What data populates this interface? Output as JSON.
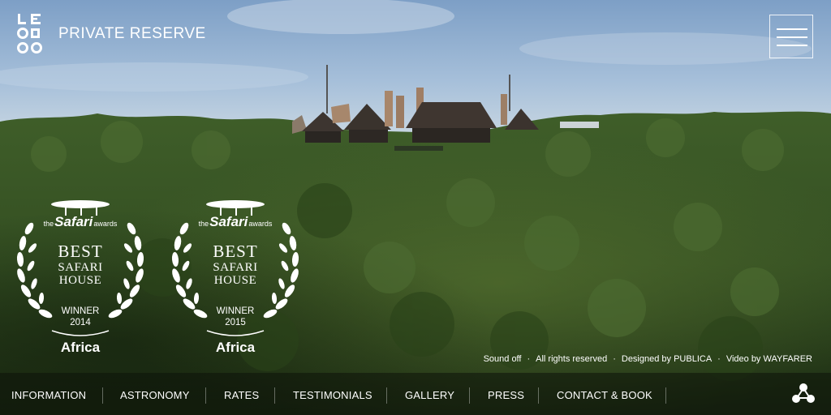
{
  "brand": {
    "name": "PRIVATE RESERVE",
    "logo_text": "LEOBO"
  },
  "header": {
    "menu_icon": "hamburger-icon"
  },
  "awards": [
    {
      "brand_pre": "the",
      "brand_main": "Safari",
      "brand_post": "awards",
      "title": "BEST",
      "line2": "SAFARI",
      "line3": "HOUSE",
      "winner": "WINNER",
      "year": "2014",
      "region": "Africa"
    },
    {
      "brand_pre": "the",
      "brand_main": "Safari",
      "brand_post": "awards",
      "title": "BEST",
      "line2": "SAFARI",
      "line3": "HOUSE",
      "winner": "WINNER",
      "year": "2015",
      "region": "Africa"
    }
  ],
  "footer": {
    "sound": "Sound off",
    "rights": "All rights reserved",
    "designed": "Designed by PUBLICA",
    "video": "Video by WAYFARER",
    "separator": "·"
  },
  "nav": {
    "items": [
      "INFORMATION",
      "ASTRONOMY",
      "RATES",
      "TESTIMONIALS",
      "GALLERY",
      "PRESS",
      "CONTACT & BOOK"
    ],
    "share_icon": "share-network-icon"
  },
  "colors": {
    "sky": "#8fb0d2",
    "forest": "#3b5a28",
    "nav_bg": "#0c120a"
  }
}
